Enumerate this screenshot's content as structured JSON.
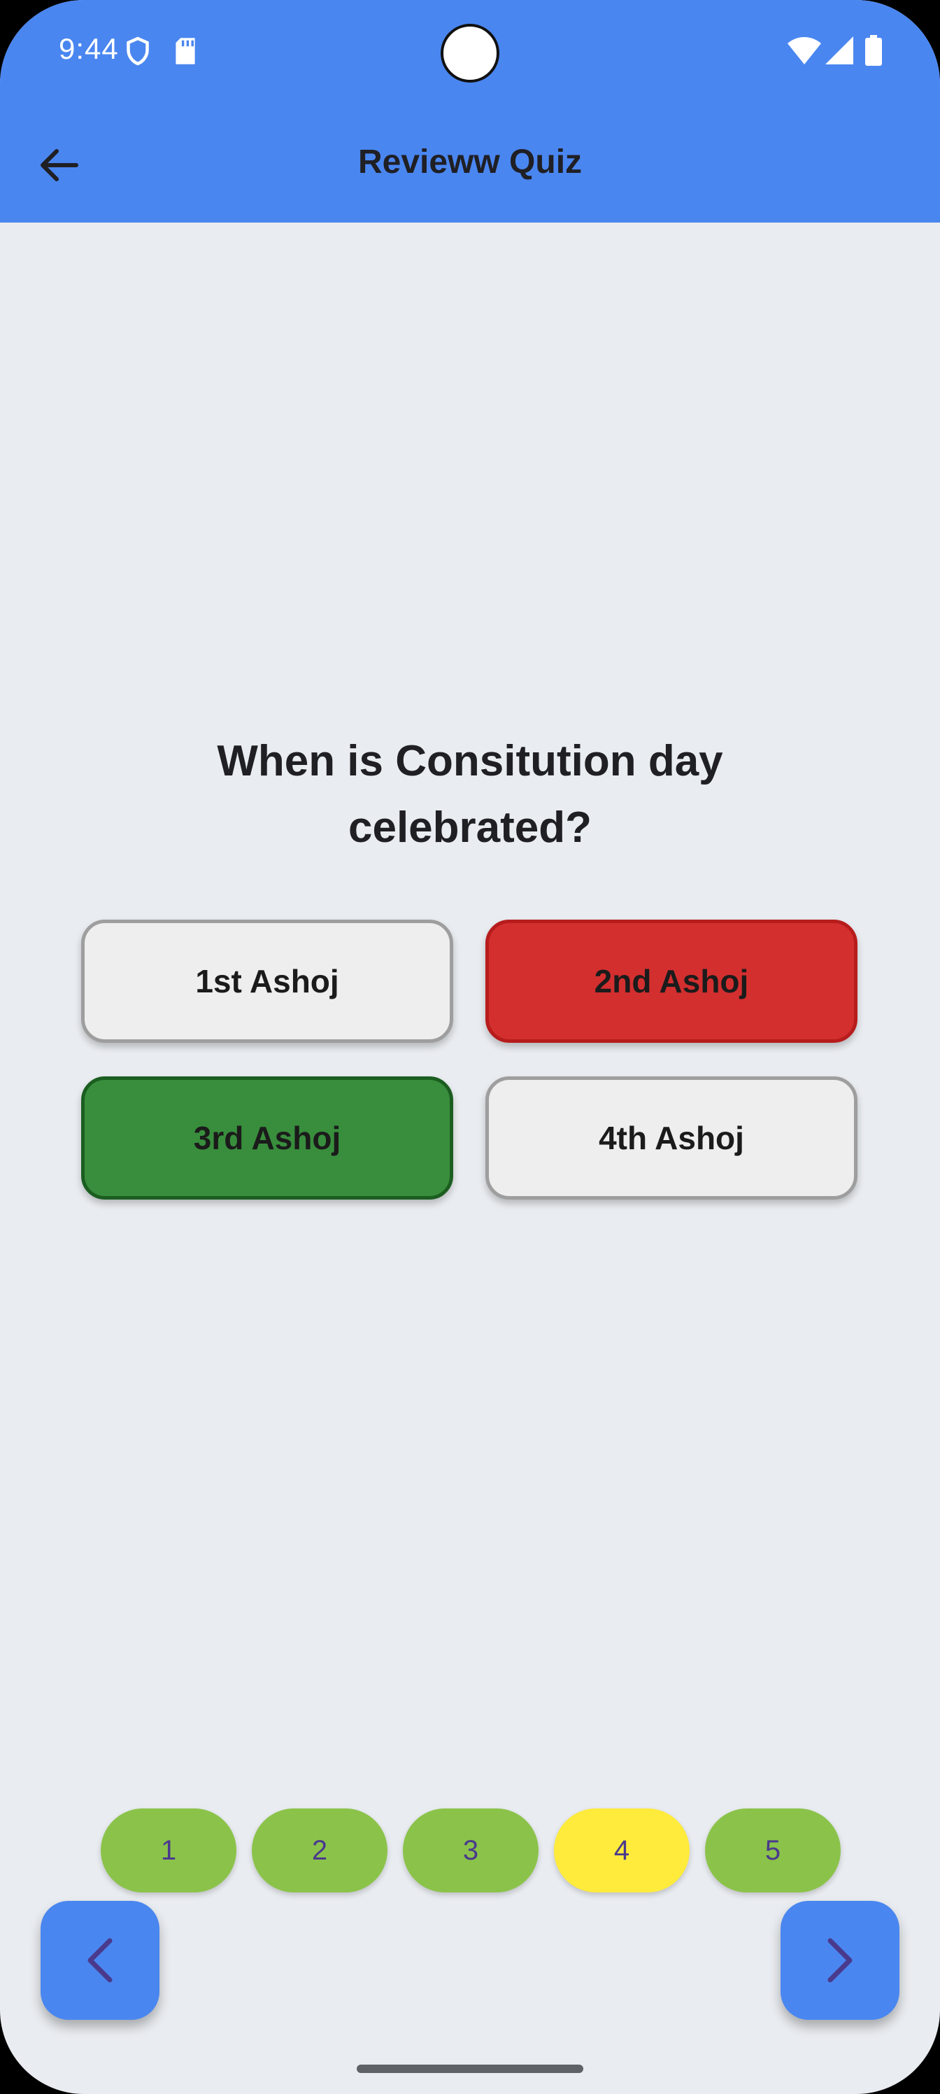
{
  "status_bar": {
    "time": "9:44",
    "icons": [
      "shield-icon",
      "sd-card-icon",
      "wifi-icon",
      "signal-icon",
      "battery-icon"
    ]
  },
  "app_bar": {
    "title": "Revieww Quiz",
    "back_icon": "arrow-left-icon"
  },
  "quiz": {
    "question": "When is Consitution day celebrated?",
    "options": [
      {
        "label": "1st Ashoj",
        "state": "neutral"
      },
      {
        "label": "2nd Ashoj",
        "state": "wrong"
      },
      {
        "label": "3rd Ashoj",
        "state": "correct"
      },
      {
        "label": "4th Ashoj",
        "state": "neutral"
      }
    ]
  },
  "pagination": {
    "pages": [
      "1",
      "2",
      "3",
      "4",
      "5"
    ],
    "current_page": "4"
  },
  "navigation": {
    "prev_icon": "chevron-left-icon",
    "next_icon": "chevron-right-icon"
  },
  "colors": {
    "primary": "#4A86F0",
    "background": "#E9ECF0",
    "correct": "#388E3C",
    "wrong": "#D32F2F",
    "page_done": "#8BC34A",
    "page_current": "#FFEB3B"
  }
}
